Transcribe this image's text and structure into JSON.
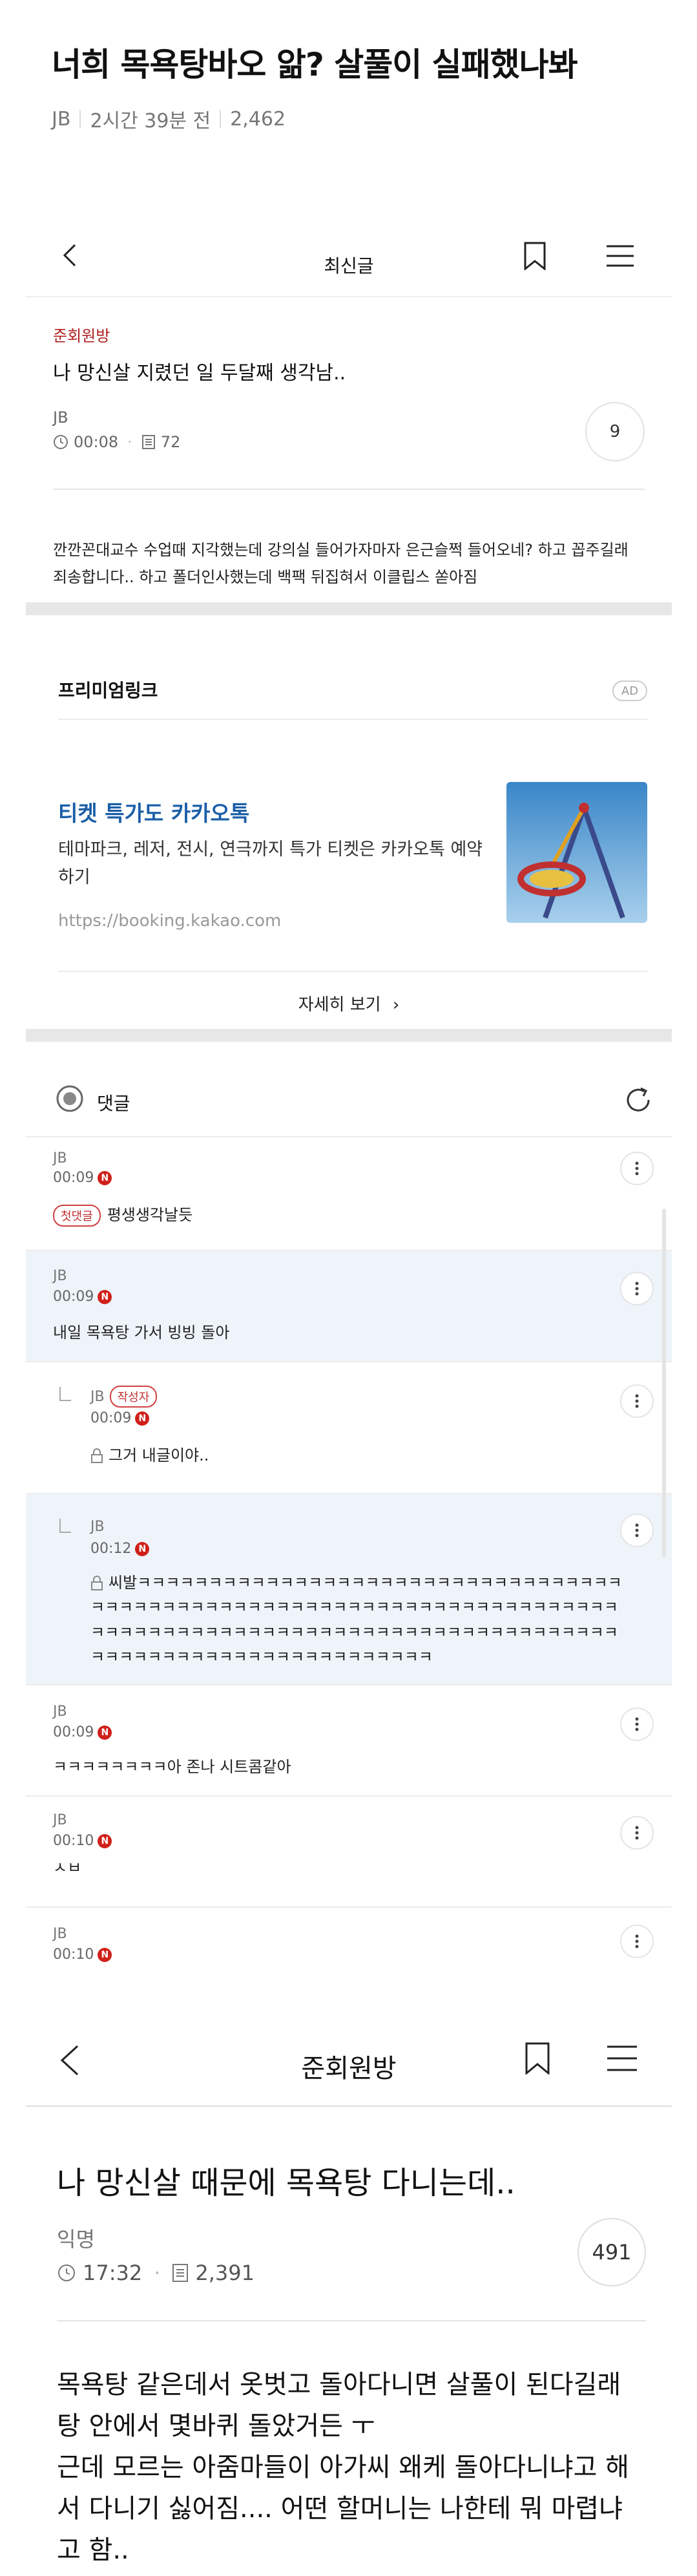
{
  "headline": {
    "title": "너희 목욕탕바오 앎? 살풀이 실패했나봐",
    "author": "JB",
    "time_ago": "2시간 39분 전",
    "views": "2,462"
  },
  "shot1": {
    "topbar_title": "최신글",
    "post": {
      "board": "준회원방",
      "title": "나 망신살 지렸던 일 두달째 생각남..",
      "author": "JB",
      "time": "00:08",
      "views": "72",
      "comment_count": "9",
      "body": "깐깐꼰대교수 수업때 지각했는데 강의실 들어가자마자 은근슬쩍 들어오네? 하고 꼽주길래 죄송합니다.. 하고 폴더인사했는데 백팩 뒤집혀서 이클립스 쏟아짐"
    },
    "ad": {
      "section_title": "프리미엄링크",
      "badge": "AD",
      "title": "티켓 특가도 카카오톡",
      "description": "테마파크, 레저, 전시, 연극까지 특가 티켓은 카카오톡 예약하기",
      "url": "https://booking.kakao.com",
      "more_label": "자세히 보기"
    },
    "comments_title": "댓글",
    "comments": [
      {
        "author": "JB",
        "time": "00:09",
        "new": "N",
        "pill": "첫댓글",
        "text": "평생생각날듯"
      },
      {
        "author": "JB",
        "time": "00:09",
        "new": "N",
        "text": "내일 목욕탕 가서 빙빙 돌아"
      },
      {
        "author": "JB",
        "pill": "작성자",
        "time": "00:09",
        "new": "N",
        "text": "그거 내글이야.."
      },
      {
        "author": "JB",
        "time": "00:12",
        "new": "N",
        "text": "씨발ㅋㅋㅋㅋㅋㅋㅋㅋㅋㅋㅋㅋㅋㅋㅋㅋㅋㅋㅋㅋㅋㅋㅋㅋㅋㅋㅋㅋㅋㅋㅋㅋㅋㅋㅋㅋㅋㅋㅋㅋㅋㅋㅋㅋㅋㅋㅋㅋㅋㅋㅋㅋㅋㅋㅋㅋㅋㅋㅋㅋㅋㅋㅋㅋㅋㅋㅋㅋㅋㅋㅋㅋㅋㅋㅋㅋㅋㅋㅋㅋㅋㅋㅋㅋㅋㅋㅋㅋㅋㅋㅋㅋㅋㅋㅋㅋㅋㅋㅋㅋㅋㅋㅋㅋㅋㅋㅋㅋㅋㅋㅋㅋㅋㅋㅋㅋㅋㅋㅋㅋㅋㅋㅋㅋㅋㅋㅋㅋㅋㅋㅋㅋ"
      },
      {
        "author": "JB",
        "time": "00:09",
        "new": "N",
        "text": "ㅋㅋㅋㅋㅋㅋㅋㅋ아 존나 시트콤같아"
      },
      {
        "author": "JB",
        "time": "00:10",
        "new": "N",
        "text": "ㅅㅂ"
      },
      {
        "author": "JB",
        "time": "00:10",
        "new": "N",
        "text": ""
      }
    ]
  },
  "shot2": {
    "topbar_title": "준회원방",
    "post": {
      "title": "나 망신살 때문에 목욕탕 다니는데..",
      "author": "익명",
      "time": "17:32",
      "views": "2,391",
      "comment_count": "491",
      "body_lines": [
        "목욕탕 같은데서 옷벗고 돌아다니면 살풀이 된다길래",
        "탕 안에서 몇바퀴 돌았거든 ㅜ",
        "근데 모르는 아줌마들이 아가씨 왜케 돌아다니냐고 해서 다니기 싫어짐.... 어떤 할머니는 나한테 뭐 마렵냐고 함.."
      ]
    }
  },
  "colors": {
    "board_red": "#b02020",
    "ad_blue": "#1a5ea8",
    "new_badge": "#d0201a",
    "highlight_bg": "#eef4fa"
  }
}
